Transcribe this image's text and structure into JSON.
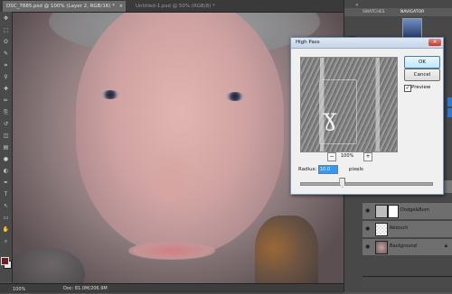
{
  "tabs": [
    {
      "label": "DSC_7885.psd @ 100% (Layer 2, RGB/16) *",
      "close": "×"
    },
    {
      "label": "Untitled-1.psd @ 50% (RGB/8) *",
      "close": ""
    }
  ],
  "toolbar": {
    "tools": [
      "move-tool",
      "marquee-tool",
      "lasso-tool",
      "quick-select-tool",
      "crop-tool",
      "eyedropper-tool",
      "healing-brush-tool",
      "brush-tool",
      "clone-stamp-tool",
      "history-brush-tool",
      "eraser-tool",
      "gradient-tool",
      "blur-tool",
      "dodge-tool",
      "pen-tool",
      "type-tool",
      "path-select-tool",
      "shape-tool",
      "hand-tool",
      "zoom-tool"
    ],
    "glyphs": [
      "✥",
      "⬚",
      "ʘ",
      "✎",
      "⌗",
      "⚲",
      "✚",
      "✏",
      "⎘",
      "↺",
      "◫",
      "▤",
      "●",
      "◐",
      "✒",
      "T",
      "↖",
      "▭",
      "✋",
      "⌕"
    ],
    "fg_color": "#6a1f24",
    "bg_color": "#e7e7e7"
  },
  "panel": {
    "tabs": [
      "SWATCHES",
      "NAVIGATOR"
    ],
    "collapse_arrow": "«"
  },
  "layers": [
    {
      "name": "Dodge&Burn",
      "visible_icon": "eye-icon"
    },
    {
      "name": "Retouch",
      "visible_icon": "eye-icon"
    },
    {
      "name": "Background",
      "visible_icon": "eye-icon",
      "lock_icon": "lock-icon"
    }
  ],
  "status": {
    "zoom": "100%",
    "doc": "Doc: 81.0M/206.9M"
  },
  "dialog": {
    "title": "High Pass",
    "ok_label": "OK",
    "cancel_label": "Cancel",
    "preview_label": "Preview",
    "preview_checked": "✓",
    "zoom_percent": "100%",
    "zoom_minus": "−",
    "zoom_plus": "+",
    "radius_label": "Radius:",
    "radius_value": "10.0",
    "radius_units": "pixels",
    "close_glyph": "×",
    "slider_value_fraction": 0.32
  }
}
